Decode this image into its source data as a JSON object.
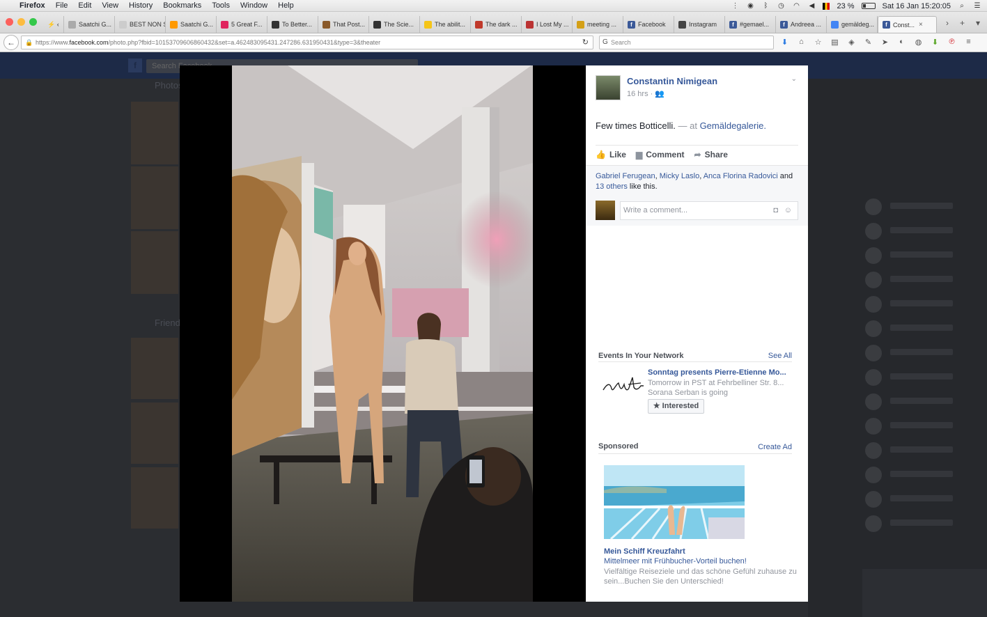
{
  "menubar": {
    "app": "Firefox",
    "items": [
      "File",
      "Edit",
      "View",
      "History",
      "Bookmarks",
      "Tools",
      "Window",
      "Help"
    ],
    "battery": "23 %",
    "clock": "Sat 16 Jan  15:20:05"
  },
  "tabs": [
    {
      "label": "Saatchi G...",
      "icon": "saatchi-icon",
      "color": "#aaaaaa"
    },
    {
      "label": "BEST NON S...",
      "icon": "blank-icon",
      "color": "#cccccc"
    },
    {
      "label": "Saatchi G...",
      "icon": "amazon-icon",
      "color": "#ff9900"
    },
    {
      "label": "5 Great F...",
      "icon": "medium-icon",
      "color": "#e0245e"
    },
    {
      "label": "To Better...",
      "icon": "nyt-icon",
      "color": "#333333"
    },
    {
      "label": "That Post...",
      "icon": "article-icon",
      "color": "#8a5a2a"
    },
    {
      "label": "The Scie...",
      "icon": "nyt-icon",
      "color": "#333333"
    },
    {
      "label": "The abilit...",
      "icon": "folder-icon",
      "color": "#f5c518"
    },
    {
      "label": "The dark ...",
      "icon": "article-icon",
      "color": "#c0392b"
    },
    {
      "label": "I Lost My ...",
      "icon": "info-icon",
      "color": "#b33"
    },
    {
      "label": "meeting ...",
      "icon": "pen-icon",
      "color": "#d4a017"
    },
    {
      "label": "Facebook",
      "icon": "facebook-icon",
      "color": "#3b5998"
    },
    {
      "label": "Instagram",
      "icon": "instagram-icon",
      "color": "#444444"
    },
    {
      "label": "#gemael...",
      "icon": "facebook-icon",
      "color": "#3b5998"
    },
    {
      "label": "Andreea ...",
      "icon": "facebook-icon",
      "color": "#3b5998"
    },
    {
      "label": "gemäldeg...",
      "icon": "google-icon",
      "color": "#4285f4"
    },
    {
      "label": "Const...",
      "icon": "facebook-icon",
      "color": "#3b5998",
      "active": true
    }
  ],
  "nav": {
    "url_prefix": "https://www.",
    "url_domain": "facebook.com",
    "url_rest": "/photo.php?fbid=10153709606860432&set=a.462483095431.247286.631950431&type=3&theater",
    "search_placeholder": "Search"
  },
  "fb_bg": {
    "search_placeholder": "Search Facebook",
    "photos_label": "Photos",
    "friends_label": "Friends"
  },
  "post": {
    "author": "Constantin Nimigean",
    "time": "16 hrs · ",
    "text": "Few times Botticelli.",
    "separator": " — at ",
    "place": "Gemäldegalerie.",
    "actions": {
      "like": "Like",
      "comment": "Comment",
      "share": "Share"
    },
    "likes": {
      "n1": "Gabriel Ferugean",
      "n2": "Micky Laslo",
      "n3": "Anca Florina Radovici",
      "and": " and",
      "others": "13 others",
      "suffix": " like this."
    },
    "comment_placeholder": "Write a comment..."
  },
  "events": {
    "header": "Events In Your Network",
    "see_all": "See All",
    "title": "Sonntag presents Pierre-Etienne Mo...",
    "when": "Tomorrow in PST at Fehrbelliner Str. 8...",
    "going": "Sorana Serban is going",
    "button": "Interested"
  },
  "sponsored": {
    "header": "Sponsored",
    "create_ad": "Create Ad",
    "title": "Mein Schiff Kreuzfahrt",
    "subtitle": "Mittelmeer mit Frühbucher-Vorteil buchen!",
    "body": "Vielfältige Reiseziele und das schöne Gefühl zuhause zu sein...Buchen Sie den Unterschied!"
  }
}
